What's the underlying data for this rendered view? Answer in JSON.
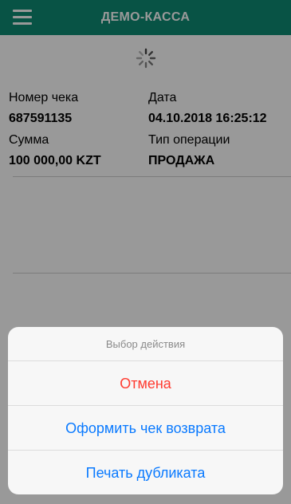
{
  "header": {
    "title": "ДЕМО-КАССА",
    "menu_icon": "hamburger-menu-icon",
    "background_color": "#0e8a73"
  },
  "loading": {
    "icon": "loading-spinner-icon"
  },
  "receipt": {
    "number_label": "Номер чека",
    "number_value": "687591135",
    "date_label": "Дата",
    "date_value": "04.10.2018 16:25:12",
    "amount_label": "Сумма",
    "amount_value": "100 000,00 KZT",
    "operation_label": "Тип операции",
    "operation_value": "ПРОДАЖА"
  },
  "action_sheet": {
    "title": "Выбор действия",
    "cancel_label": "Отмена",
    "return_label": "Оформить чек возврата",
    "print_duplicate_label": "Печать дубликата",
    "destructive_color": "#ff3b30",
    "action_color": "#0a7aff"
  }
}
